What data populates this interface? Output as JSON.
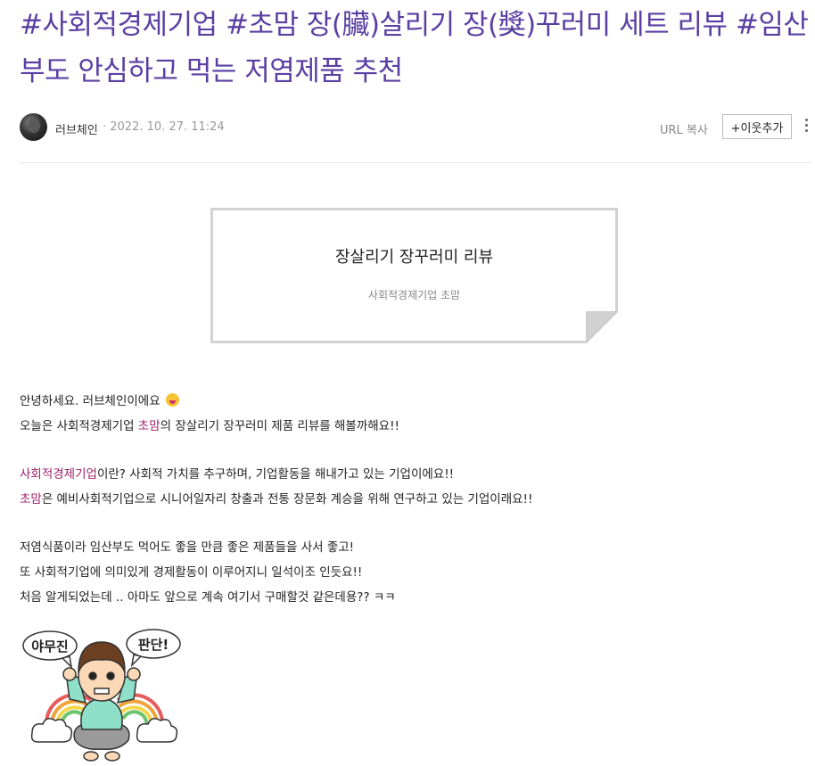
{
  "post": {
    "title": "#사회적경제기업 #초맘 장(臟)살리기 장(獎)꾸러미 세트 리뷰 #임산부도 안심하고 먹는 저염제품 추천",
    "author": "러브체인",
    "date": "· 2022. 10. 27. 11:24",
    "url_copy_label": "URL 복사",
    "add_neighbor_label": "+이웃추가"
  },
  "quote": {
    "title": "장살리기 장꾸러미 리뷰",
    "subtitle": "사회적경제기업 초맘"
  },
  "body": {
    "line1": "안녕하세요. 러브체인이에요",
    "line2_a": "오늘은 사회적경제기업 ",
    "line2_hl": "초맘",
    "line2_b": "의 장살리기 장꾸러미 제품 리뷰를 해볼까해요!!",
    "line3_hl": "사회적경제기업",
    "line3_b": "이란? 사회적 가치를 추구하며, 기업활동을 해내가고 있는 기업이에요!!",
    "line4_hl": "초맘",
    "line4_b": "은 예비사회적기업으로 시니어일자리 창출과 전통 장문화 계승을 위해 연구하고 있는 기업이래요!!",
    "line5": "저염식품이라 임산부도 먹어도 좋을 만큼 좋은 제품들을 사서 좋고!",
    "line6": "또 사회적기업에 의미있게 경제활동이 이루어지니 일석이조 인듯요!!",
    "line7": "처음 알게되었는데 .. 아마도 앞으로 계속 여기서 구매할것 같은데용?? ㅋㅋ"
  },
  "sticker": {
    "bubble_left": "야무진",
    "bubble_right": "판단!"
  },
  "colors": {
    "title": "#5b3fa3",
    "highlight": "#a0216b"
  }
}
